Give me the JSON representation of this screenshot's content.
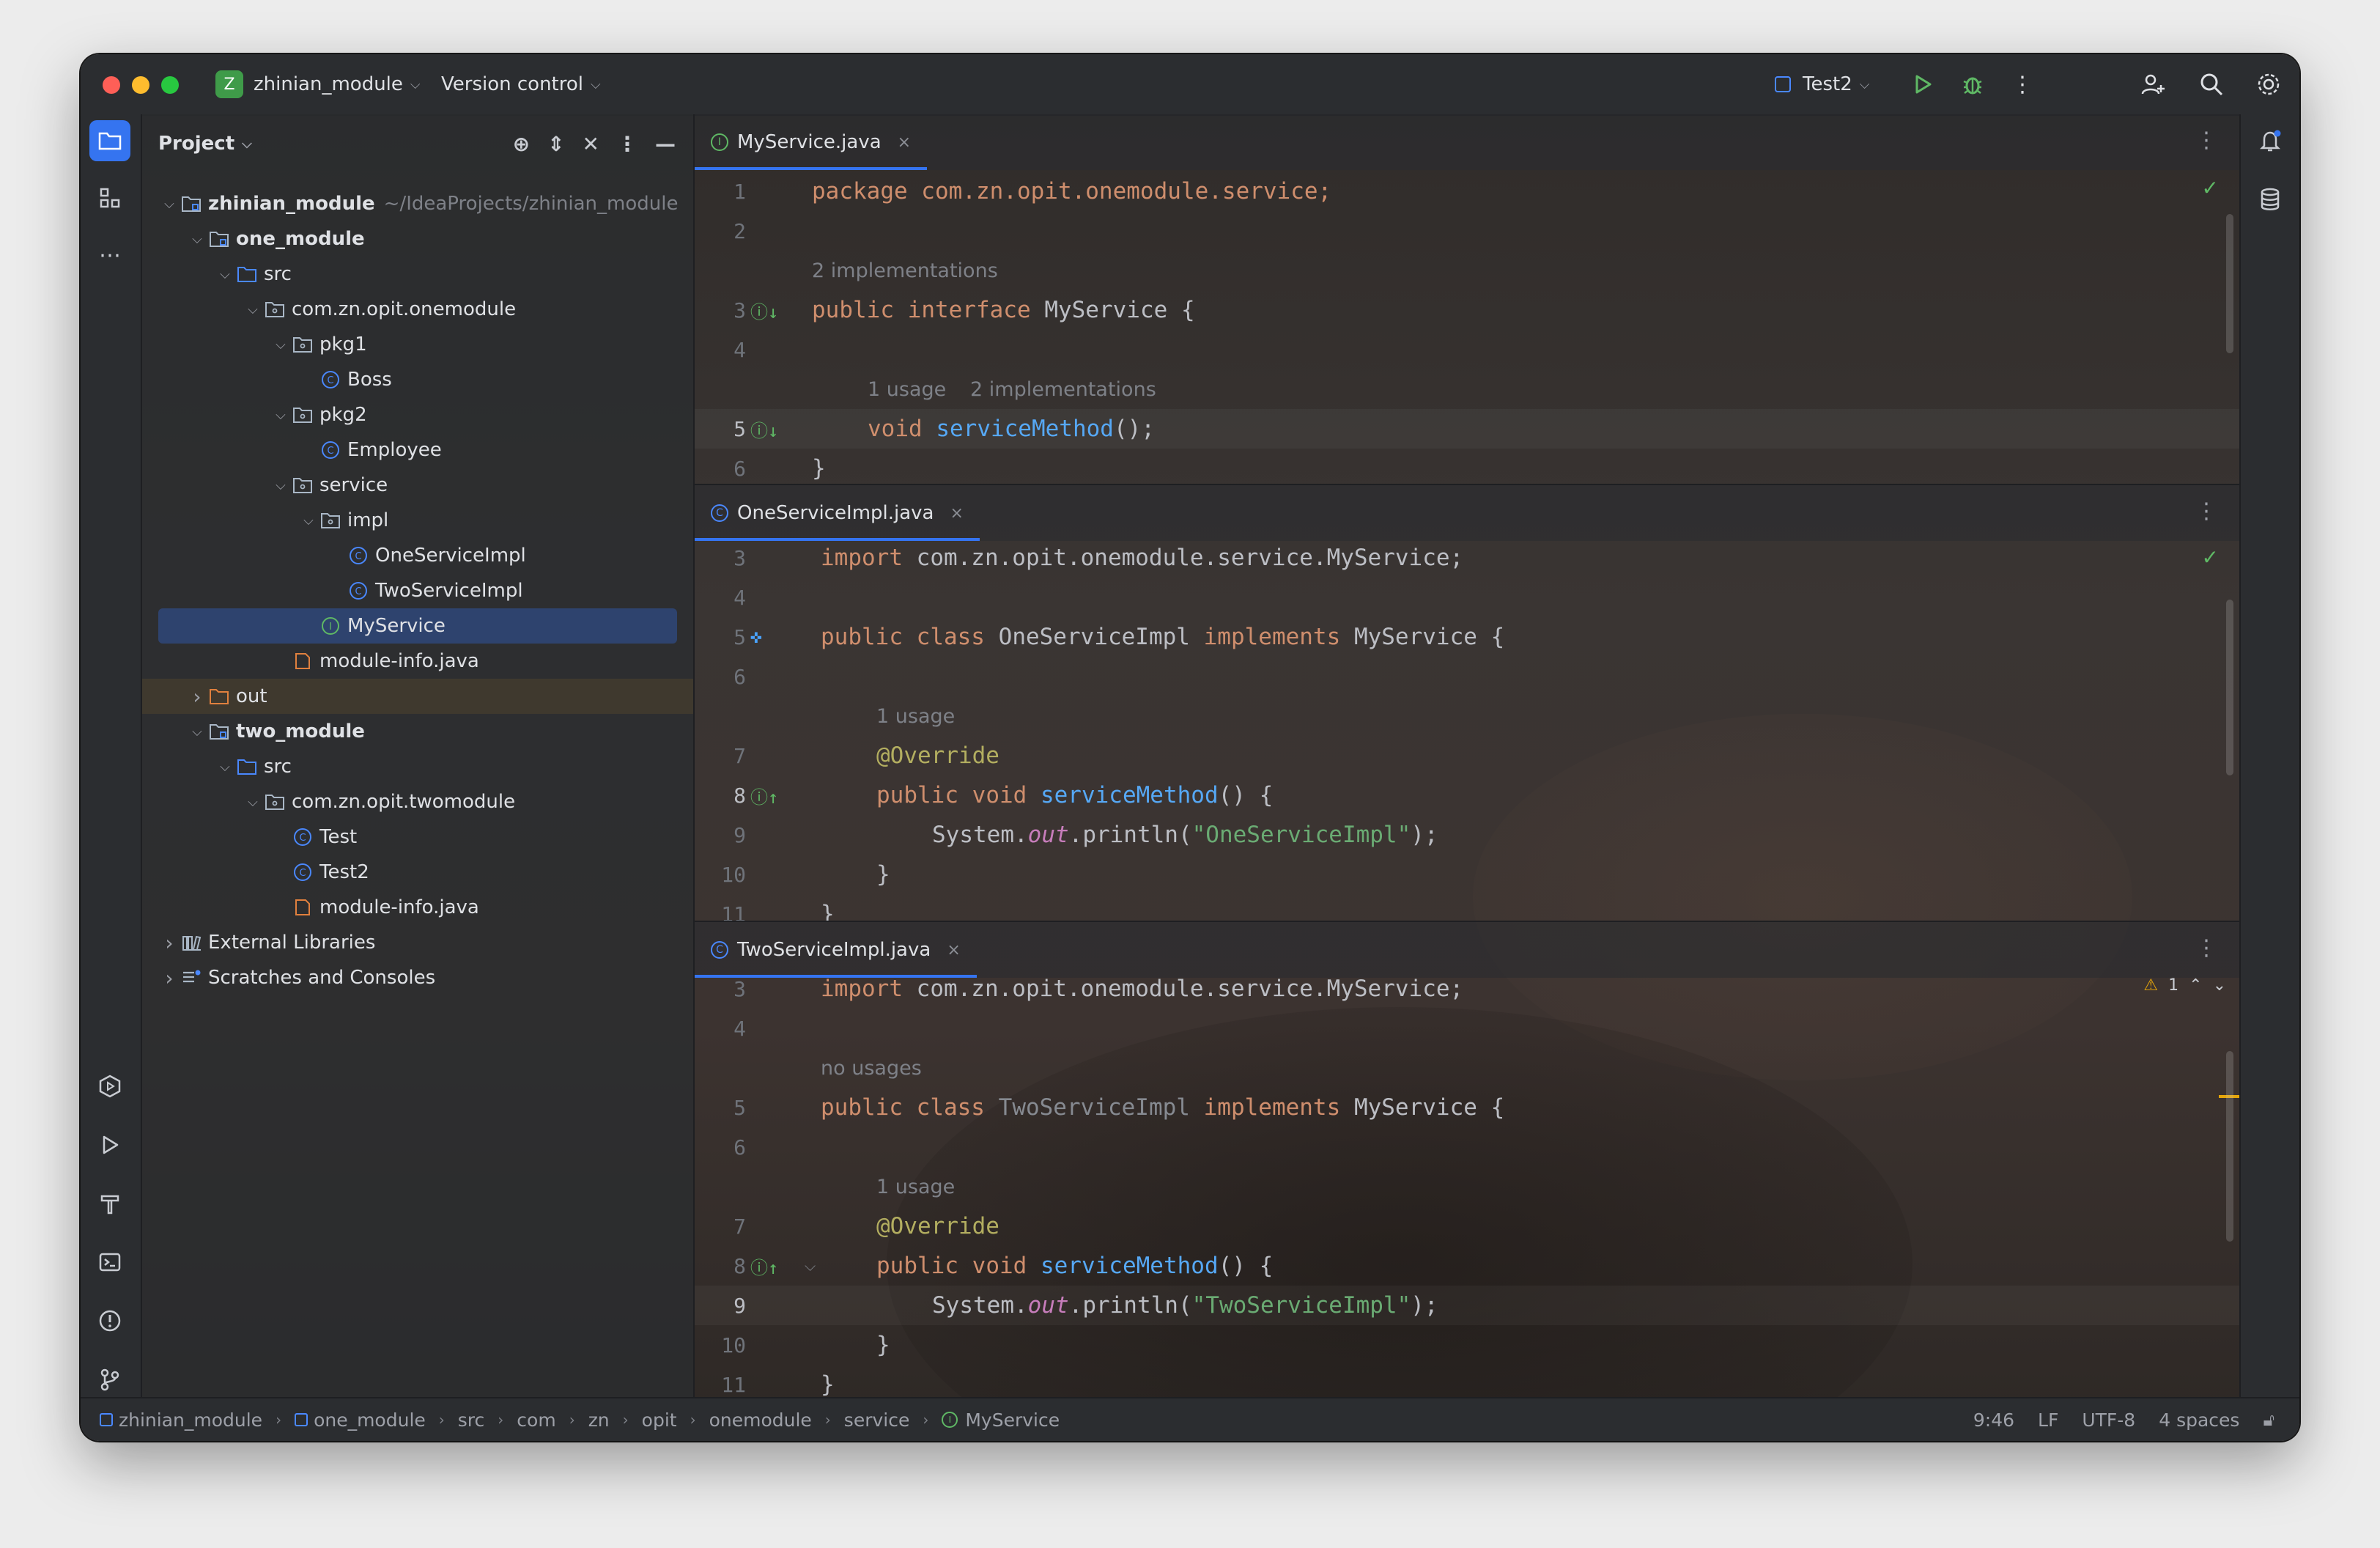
{
  "window": {
    "project_name": "zhinian_module",
    "project_badge": "Z",
    "vcs_label": "Version control",
    "run_config": "Test2"
  },
  "project_panel": {
    "title": "Project",
    "tree": [
      {
        "label": "zhinian_module",
        "path_hint": "~/IdeaProjects/zhinian_module",
        "depth": 0,
        "arrow": "down",
        "icon": "module-folder",
        "bold": true
      },
      {
        "label": "one_module",
        "depth": 1,
        "arrow": "down",
        "icon": "module-folder",
        "bold": true
      },
      {
        "label": "src",
        "depth": 2,
        "arrow": "down",
        "icon": "source-folder"
      },
      {
        "label": "com.zn.opit.onemodule",
        "depth": 3,
        "arrow": "down",
        "icon": "package"
      },
      {
        "label": "pkg1",
        "depth": 4,
        "arrow": "down",
        "icon": "package"
      },
      {
        "label": "Boss",
        "depth": 5,
        "icon": "class"
      },
      {
        "label": "pkg2",
        "depth": 4,
        "arrow": "down",
        "icon": "package"
      },
      {
        "label": "Employee",
        "depth": 5,
        "icon": "class"
      },
      {
        "label": "service",
        "depth": 4,
        "arrow": "down",
        "icon": "package"
      },
      {
        "label": "impl",
        "depth": 5,
        "arrow": "down",
        "icon": "package"
      },
      {
        "label": "OneServiceImpl",
        "depth": 6,
        "icon": "class"
      },
      {
        "label": "TwoServiceImpl",
        "depth": 6,
        "icon": "class"
      },
      {
        "label": "MyService",
        "depth": 5,
        "icon": "interface",
        "selected": true
      },
      {
        "label": "module-info.java",
        "depth": 4,
        "icon": "module-info"
      },
      {
        "label": "out",
        "depth": 1,
        "arrow": "right",
        "icon": "excluded-folder",
        "highlight": true
      },
      {
        "label": "two_module",
        "depth": 1,
        "arrow": "down",
        "icon": "module-folder",
        "bold": true
      },
      {
        "label": "src",
        "depth": 2,
        "arrow": "down",
        "icon": "source-folder"
      },
      {
        "label": "com.zn.opit.twomodule",
        "depth": 3,
        "arrow": "down",
        "icon": "package"
      },
      {
        "label": "Test",
        "depth": 4,
        "icon": "class"
      },
      {
        "label": "Test2",
        "depth": 4,
        "icon": "class"
      },
      {
        "label": "module-info.java",
        "depth": 4,
        "icon": "module-info"
      },
      {
        "label": "External Libraries",
        "depth": 0,
        "arrow": "right",
        "icon": "library"
      },
      {
        "label": "Scratches and Consoles",
        "depth": 0,
        "arrow": "right",
        "icon": "scratches"
      }
    ]
  },
  "editors": {
    "pane1": {
      "tab": "MyService.java",
      "line1": "package com.zn.opit.onemodule.service;",
      "hint_impls": "2 implementations",
      "line3_kw1": "public",
      "line3_kw2": "interface",
      "line3_name": "MyService {",
      "hint_usage": "1 usage",
      "hint_impls2": "2 implementations",
      "line5_kw": "void",
      "line5_fn": "serviceMethod",
      "line5_rest": "();",
      "line6": "}",
      "line_numbers": [
        "1",
        "2",
        "3",
        "4",
        "5",
        "6"
      ]
    },
    "pane2": {
      "tab": "OneServiceImpl.java",
      "import_kw": "import",
      "import_path": "com.zn.opit.onemodule.service.MyService;",
      "kw_public": "public",
      "kw_class": "class",
      "class_name": "OneServiceImpl",
      "kw_implements": "implements",
      "iface": "MyService {",
      "hint_usage": "1 usage",
      "annotation": "@Override",
      "kw_void": "void",
      "method": "serviceMethod",
      "method_rest": "() {",
      "print_obj": "System.",
      "print_field": "out",
      "print_call": ".println(",
      "print_str": "\"OneServiceImpl\"",
      "print_end": ");",
      "close1": "}",
      "close2": "}",
      "line_numbers": [
        "3",
        "4",
        "5",
        "6",
        "7",
        "8",
        "9",
        "10",
        "11"
      ]
    },
    "pane3": {
      "tab": "TwoServiceImpl.java",
      "import_kw": "import",
      "import_path": "com.zn.opit.onemodule.service.MyService;",
      "hint_nousage": "no usages",
      "kw_public": "public",
      "kw_class": "class",
      "class_name": "TwoServiceImpl",
      "kw_implements": "implements",
      "iface": "MyService {",
      "hint_usage": "1 usage",
      "annotation": "@Override",
      "kw_void": "void",
      "method": "serviceMethod",
      "method_rest": "() {",
      "print_obj": "System.",
      "print_field": "out",
      "print_call": ".println(",
      "print_str": "\"TwoServiceImpl\"",
      "print_end": ");",
      "close1": "}",
      "close2": "}",
      "warnings": "1",
      "line_numbers": [
        "3",
        "4",
        "5",
        "6",
        "7",
        "8",
        "9",
        "10",
        "11"
      ]
    }
  },
  "statusbar": {
    "breadcrumbs": [
      "zhinian_module",
      "one_module",
      "src",
      "com",
      "zn",
      "opit",
      "onemodule",
      "service",
      "MyService"
    ],
    "position": "9:46",
    "line_sep": "LF",
    "encoding": "UTF-8",
    "indent": "4 spaces"
  },
  "colors": {
    "accent": "#3574f0",
    "keyword": "#cf8e6d",
    "function": "#56a8f5",
    "string": "#6aab73",
    "annotation": "#b3ae60"
  }
}
